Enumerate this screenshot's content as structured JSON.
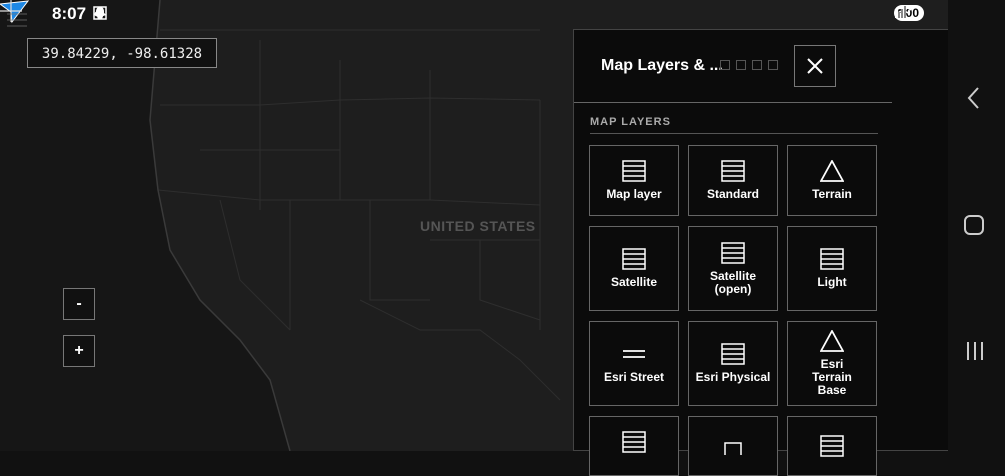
{
  "status": {
    "time": "8:07",
    "battery": "100"
  },
  "map": {
    "coords": "39.84229, -98.61328",
    "country": "UNITED STATES",
    "zoom_out": "-",
    "zoom_in": "+"
  },
  "panel": {
    "title": "Map Layers & ...",
    "section": "MAP LAYERS",
    "layers": [
      {
        "label": "Map layer",
        "icon": "grid-icon"
      },
      {
        "label": "Standard",
        "icon": "grid-icon"
      },
      {
        "label": "Terrain",
        "icon": "triangle-icon"
      },
      {
        "label": "Satellite",
        "icon": "grid-icon"
      },
      {
        "label": "Satellite (open)",
        "icon": "grid-icon"
      },
      {
        "label": "Light",
        "icon": "grid-icon"
      },
      {
        "label": "Esri Street",
        "icon": "lines-icon"
      },
      {
        "label": "Esri Physical",
        "icon": "grid-icon"
      },
      {
        "label": "Esri Terrain Base",
        "icon": "triangle-icon"
      }
    ]
  }
}
